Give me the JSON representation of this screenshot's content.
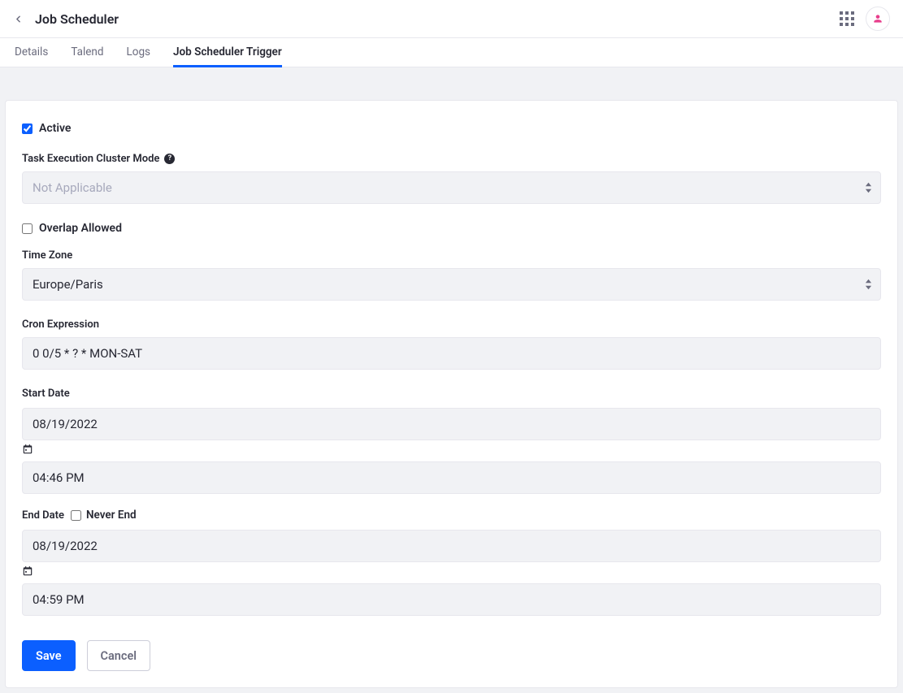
{
  "header": {
    "title": "Job Scheduler"
  },
  "tabs": {
    "details": "Details",
    "talend": "Talend",
    "logs": "Logs",
    "trigger": "Job Scheduler Trigger"
  },
  "form": {
    "active_label": "Active",
    "cluster_mode_label": "Task Execution Cluster Mode",
    "cluster_mode_value": "Not Applicable",
    "overlap_label": "Overlap Allowed",
    "tz_label": "Time Zone",
    "tz_value": "Europe/Paris",
    "cron_label": "Cron Expression",
    "cron_value": "0 0/5 * ? * MON-SAT",
    "start_date_label": "Start Date",
    "start_date_value": "08/19/2022",
    "start_time_value": "04:46 PM",
    "end_date_label": "End Date",
    "never_end_label": "Never End",
    "end_date_value": "08/19/2022",
    "end_time_value": "04:59 PM"
  },
  "buttons": {
    "save": "Save",
    "cancel": "Cancel"
  }
}
